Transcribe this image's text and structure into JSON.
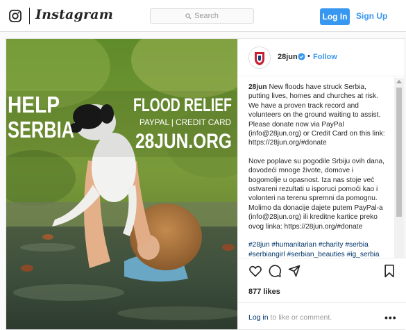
{
  "header": {
    "wordmark": "Instagram",
    "search_placeholder": "Search",
    "login_label": "Log In",
    "signup_label": "Sign Up"
  },
  "post": {
    "username": "28jun",
    "separator": "•",
    "follow_label": "Follow",
    "poster": {
      "left_line1": "HELP",
      "left_line2": "SERBIA",
      "right_line1": "FLOOD RELIEF",
      "right_line2": "PAYPAL | CREDIT CARD",
      "right_line3": "28JUN.ORG"
    },
    "caption_en": "New floods have struck Serbia, putting lives, homes and churches at risk. We have a proven track record and volunteers on the ground waiting to assist. Please donate now via PayPal (info@28jun.org) or Credit Card on this link: https://28jun.org/#donate",
    "caption_sr": "Nove poplave su pogodile Srbiju ovih dana, dovodeći mnoge živote, domove i bogomolje u opasnost. Iza nas stoje već ostvareni rezultati u isporuci pomoći kao i volonteri na terenu spremni da pomognu. Molimo da donacije dajete putem PayPal-a (info@28jun.org) ili kreditne kartice preko ovog linka: https://28jun.org/#donate",
    "hashtags": "#28jun #humanitarian #charity #serbia #serbiangirl #serbian_beauties #ig_serbia #instagramserbia #instaserbia #lifestyleserbia #yoserbia #serbianpeople",
    "likes": "877 likes",
    "login_link": "Log in",
    "login_suffix": " to like or comment.",
    "more": "•••"
  },
  "colors": {
    "accent": "#3897f0",
    "link_dark": "#003569",
    "text": "#262626",
    "muted": "#999999"
  },
  "icons": [
    "instagram-glyph-icon",
    "search-icon",
    "verified-badge-icon",
    "heart-icon",
    "comment-icon",
    "share-icon",
    "bookmark-icon"
  ]
}
